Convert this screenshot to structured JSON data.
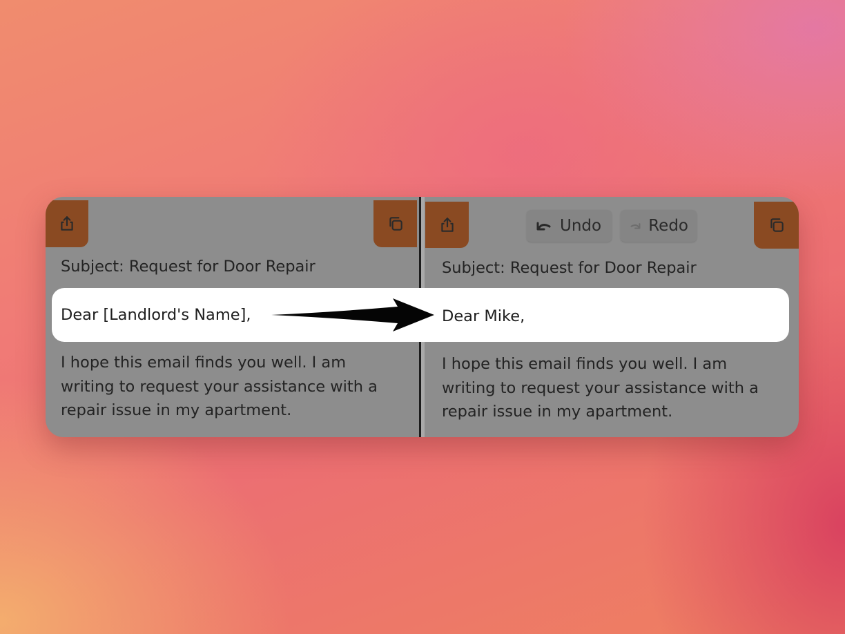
{
  "left_pane": {
    "subject": "Subject: Request for Door Repair",
    "greeting": "Dear [Landlord's Name],",
    "body": "I hope this email finds you well. I am writing to request your assistance with a repair issue in my apartment."
  },
  "right_pane": {
    "toolbar": {
      "undo_label": "Undo",
      "redo_label": "Redo"
    },
    "subject": "Subject: Request for Door Repair",
    "greeting": "Dear Mike,",
    "body": "I hope this email finds you well. I am writing to request your assistance with a repair issue in my apartment."
  },
  "icons": {
    "share": "share-icon",
    "copy": "copy-icon",
    "undo": "undo-icon",
    "redo": "redo-icon",
    "arrow": "arrow-right-icon"
  },
  "colors": {
    "accent_button": "#8a4a22",
    "panel_background": "#8d8d8d",
    "highlight": "#ffffff"
  }
}
